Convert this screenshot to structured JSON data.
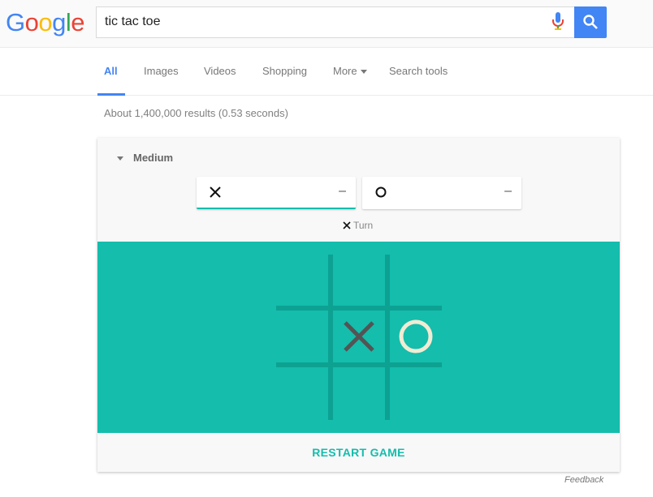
{
  "logo": {
    "text": "Google",
    "letters": [
      {
        "ch": "G",
        "color": "#4285f4"
      },
      {
        "ch": "o",
        "color": "#ea4335"
      },
      {
        "ch": "o",
        "color": "#fbbc05"
      },
      {
        "ch": "g",
        "color": "#4285f4"
      },
      {
        "ch": "l",
        "color": "#34a853"
      },
      {
        "ch": "e",
        "color": "#ea4335"
      }
    ]
  },
  "search": {
    "query": "tic tac toe"
  },
  "nav": {
    "all": "All",
    "images": "Images",
    "videos": "Videos",
    "shopping": "Shopping",
    "more": "More",
    "search_tools": "Search tools"
  },
  "stats": "About 1,400,000 results (0.53 seconds)",
  "game": {
    "difficulty": "Medium",
    "score_x": "–",
    "score_o": "–",
    "turn_label": "Turn",
    "board": [
      "",
      "",
      "",
      "",
      "X",
      "O",
      "",
      "",
      ""
    ],
    "restart_label": "RESTART GAME",
    "colors": {
      "board": "#14bdac",
      "grid": "#0da192",
      "x": "#545454",
      "o": "#f2ebd3"
    }
  },
  "feedback": "Feedback"
}
